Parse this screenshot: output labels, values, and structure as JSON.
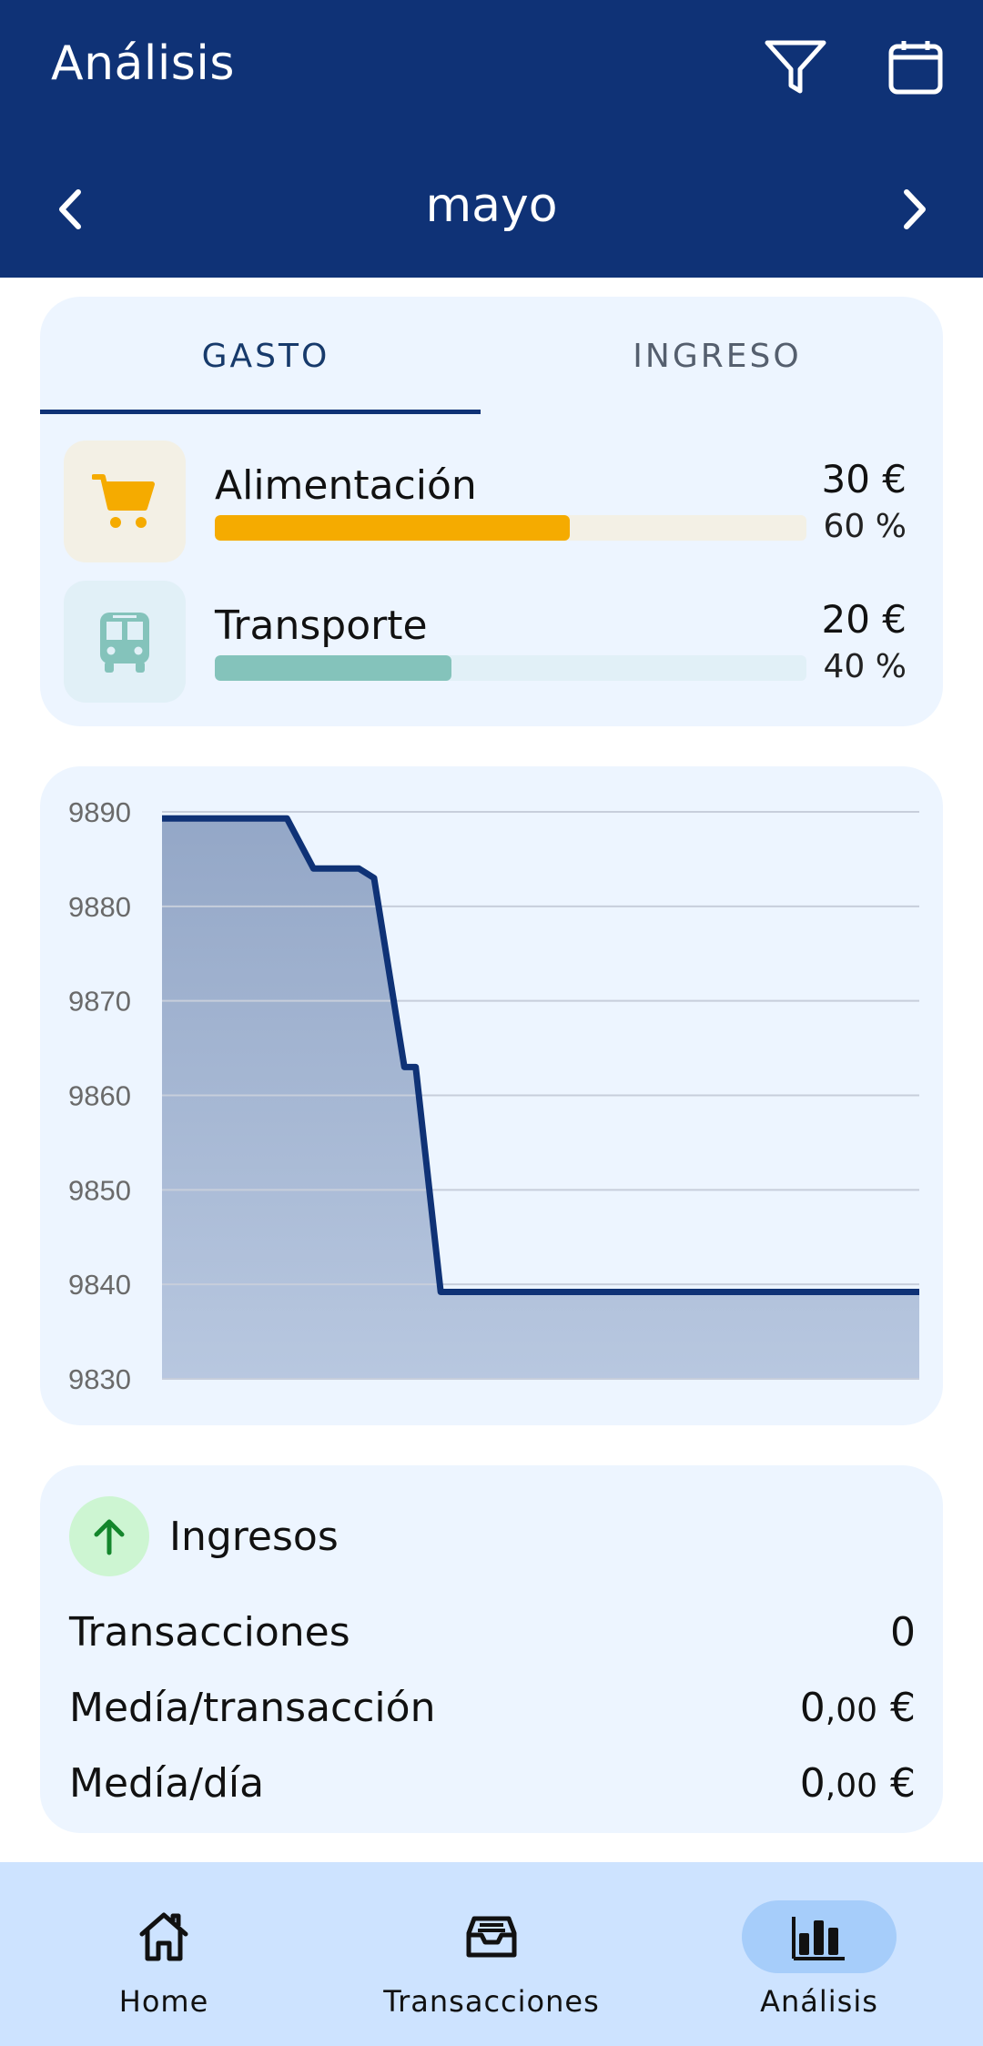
{
  "appbar": {
    "title": "Análisis",
    "icons": [
      "filter-icon",
      "calendar-icon"
    ],
    "month": "mayo"
  },
  "tabs": [
    {
      "label": "GASTO",
      "active": true
    },
    {
      "label": "INGRESO",
      "active": false
    }
  ],
  "categories": [
    {
      "name": "Alimentación",
      "amount": "30 €",
      "percent_label": "60 %",
      "fraction": 0.6,
      "icon": "cart-icon",
      "bar_color": "#f5ab00",
      "track_color": "#f3f0e5",
      "icon_bg": "#f3f0e5",
      "icon_color": "#f5ab00"
    },
    {
      "name": "Transporte",
      "amount": "20 €",
      "percent_label": "40 %",
      "fraction": 0.4,
      "icon": "bus-icon",
      "bar_color": "#84c3bb",
      "track_color": "#e1f0f7",
      "icon_bg": "#e1f0f7",
      "icon_color": "#84c3bb"
    }
  ],
  "chart_data": {
    "type": "area",
    "ylim": [
      9830,
      9890
    ],
    "yticks": [
      "9890",
      "9880",
      "9870",
      "9860",
      "9850",
      "9840",
      "9830"
    ],
    "x": [
      0,
      0.125,
      0.165,
      0.2,
      0.26,
      0.28,
      0.32,
      0.335,
      0.368,
      0.398,
      0.46,
      1
    ],
    "values": [
      9889.3,
      9889.3,
      9889.3,
      9884,
      9884,
      9883,
      9863,
      9863,
      9839.2,
      9839.2,
      9839.2,
      9839.2
    ],
    "line_color": "#0f3276",
    "grid": true
  },
  "stats": {
    "title": "Ingresos",
    "icon": "arrow-up-icon",
    "rows": [
      {
        "label": "Transacciones",
        "value_main": "0",
        "value_small": ""
      },
      {
        "label": "Medía/transacción",
        "value_main": "0",
        "value_small": ",00",
        "currency": " €"
      },
      {
        "label": "Medía/día",
        "value_main": "0",
        "value_small": ",00",
        "currency": " €"
      }
    ]
  },
  "bottom_nav": [
    {
      "label": "Home",
      "icon": "home-icon",
      "active": false
    },
    {
      "label": "Transacciones",
      "icon": "inbox-icon",
      "active": false
    },
    {
      "label": "Análisis",
      "icon": "bar-chart-icon",
      "active": true
    }
  ]
}
